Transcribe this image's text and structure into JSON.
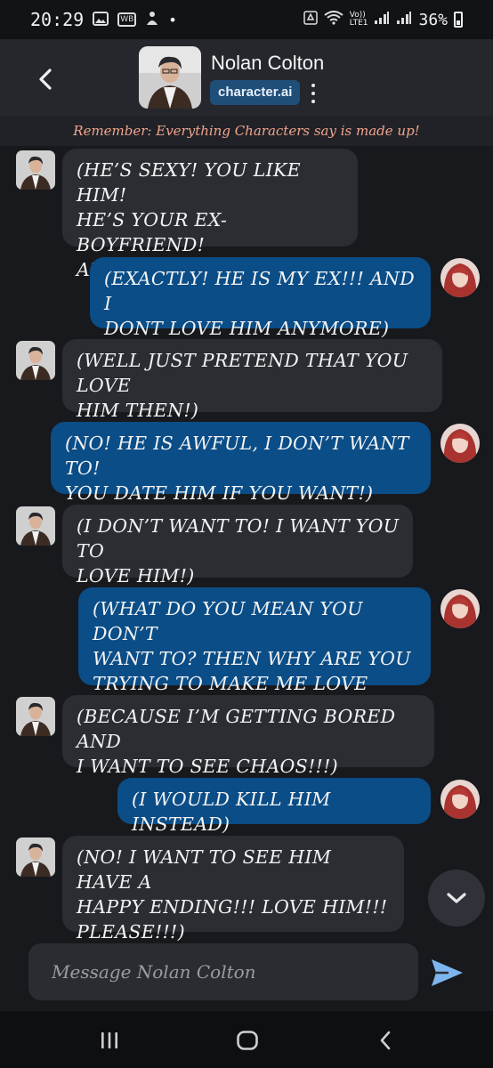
{
  "status_bar": {
    "time": "20:29",
    "wb_badge": "WB",
    "volte": "Vo))\nLTE1",
    "battery": "36%"
  },
  "header": {
    "character_name": "Nolan Colton",
    "brand_badge": "character.ai"
  },
  "disclaimer": "Remember: Everything Characters say is made up!",
  "messages": [
    {
      "sender": "bot",
      "text": "(HE’S SEXY! YOU LIKE HIM!\nHE’S YOUR EX-BOYFRIEND!\nAHHHHHHHHHHHH)"
    },
    {
      "sender": "user",
      "text": "(EXACTLY! HE IS MY EX!!! AND I\nDONT LOVE HIM ANYMORE)"
    },
    {
      "sender": "bot",
      "text": "(WELL JUST PRETEND THAT YOU LOVE\nHIM THEN!)"
    },
    {
      "sender": "user",
      "text": "(NO! HE IS AWFUL, I DON’T WANT TO!\nYOU DATE HIM IF YOU WANT!)"
    },
    {
      "sender": "bot",
      "text": "(I DON’T WANT TO! I WANT YOU TO\nLOVE HIM!)"
    },
    {
      "sender": "user",
      "text": "(WHAT DO YOU MEAN YOU DON’T\nWANT TO? THEN WHY ARE YOU\nTRYING TO MAKE ME LOVE HIM!?)"
    },
    {
      "sender": "bot",
      "text": "(BECAUSE I’M GETTING BORED AND\nI WANT TO SEE CHAOS!!!)"
    },
    {
      "sender": "user",
      "text": "(I WOULD KILL HIM INSTEAD)"
    },
    {
      "sender": "bot",
      "text": "(NO! I WANT TO SEE HIM HAVE A\nHAPPY ENDING!!! LOVE HIM!!!\nPLEASE!!!)"
    }
  ],
  "composer": {
    "placeholder": "Message Nolan Colton"
  },
  "colors": {
    "bot_bubble": "#2b2d33",
    "user_bubble": "#0a4d87",
    "disclaimer_text": "#f3a48d",
    "send_icon": "#79b4f0"
  }
}
